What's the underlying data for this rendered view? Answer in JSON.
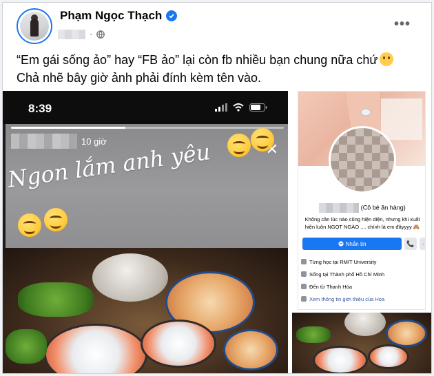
{
  "post": {
    "author": "Phạm Ngọc Thạch",
    "text_line1": "“Em gái sống ảo” hay “FB ảo” lại còn fb nhiều bạn chung nữa chứ",
    "text_line2": "Chả nhẽ bây giờ ảnh phải đính kèm tên vào.",
    "more_label": "•••"
  },
  "story": {
    "clock": "8:39",
    "time_ago": "10 giờ",
    "caption": "Ngon lắm anh yêu",
    "close_label": "✕",
    "progress": 0.42
  },
  "profile": {
    "nickname": "(Cô bé ăn hàng)",
    "bio": "Không cần lúc nào cũng hiện diện, nhưng khi xuất hiện luôn NGỌT NGÀO .... chính là em đâyyyy 🙈",
    "message_label": "Nhắn tin",
    "call_label": "📞",
    "more_label": "···",
    "info": [
      {
        "icon": "graduation-cap-icon",
        "text": "Từng học tại RMIT University"
      },
      {
        "icon": "home-icon",
        "text": "Sống tại Thành phố Hồ Chí Minh"
      },
      {
        "icon": "location-pin-icon",
        "text": "Đến từ Thanh Hóa"
      }
    ],
    "see_more": "Xem thông tin giới thiệu của Hoa"
  },
  "colors": {
    "brand": "#1877f2",
    "text": "#050505",
    "secondary": "#65676b"
  }
}
